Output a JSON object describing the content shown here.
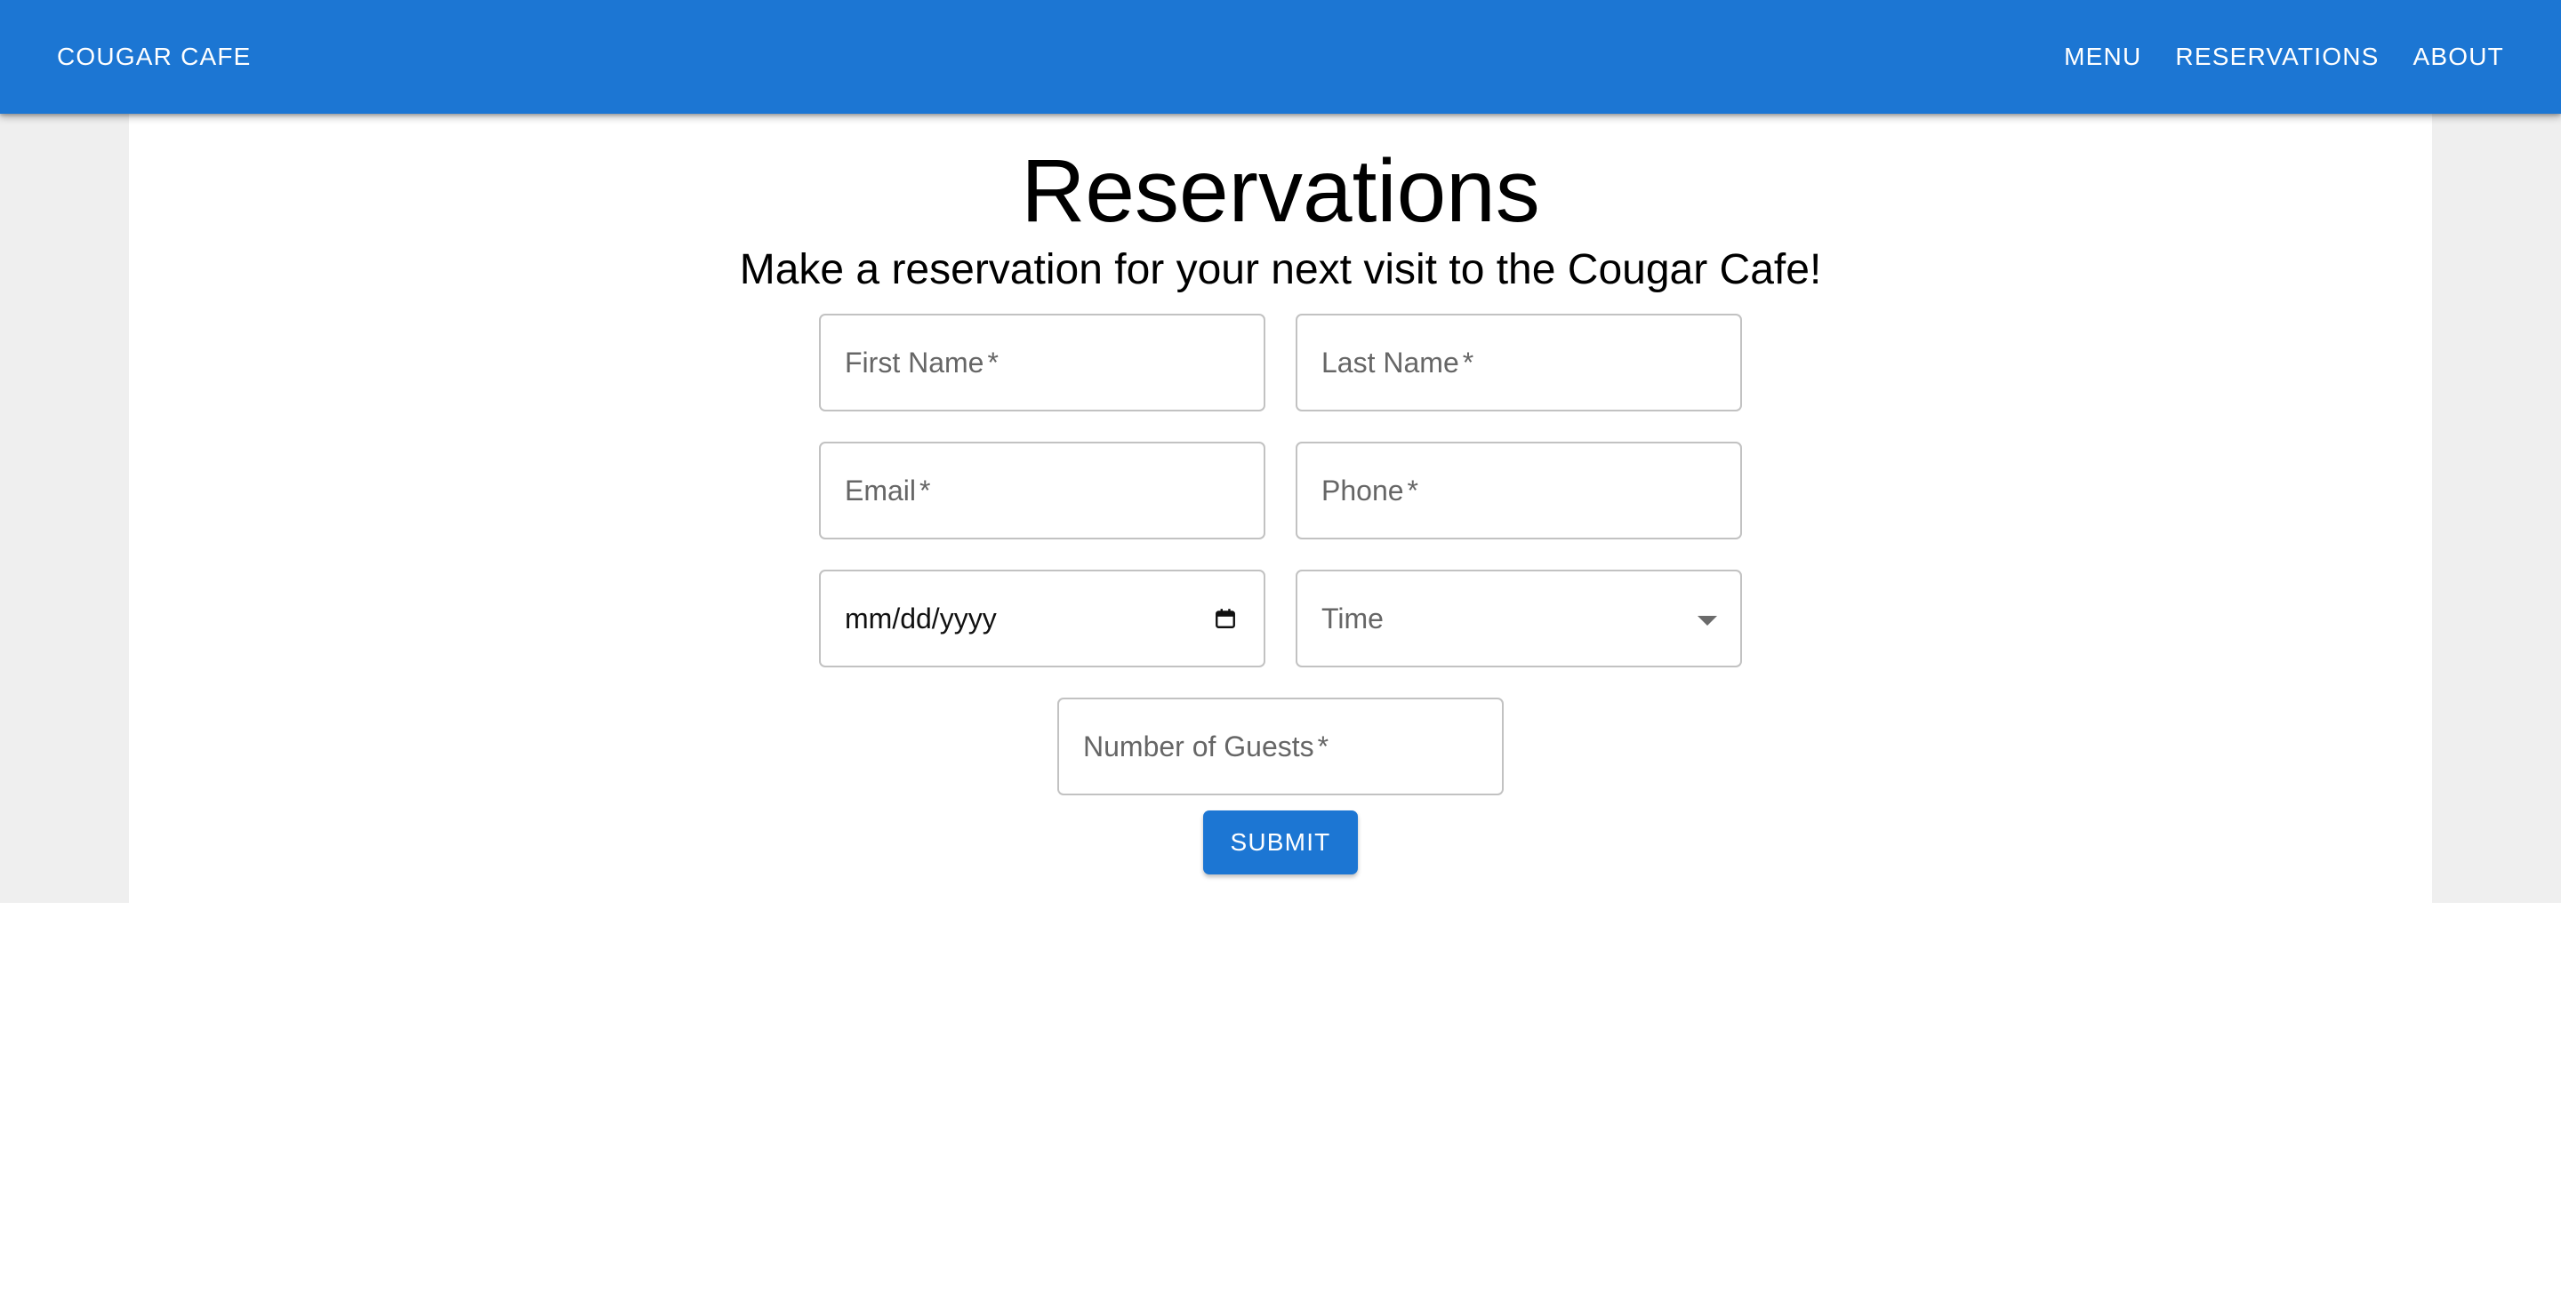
{
  "header": {
    "brand": "COUGAR CAFE",
    "nav": {
      "menu": "MENU",
      "reservations": "RESERVATIONS",
      "about": "ABOUT"
    }
  },
  "page": {
    "title": "Reservations",
    "subtitle": "Make a reservation for your next visit to the Cougar Cafe!"
  },
  "form": {
    "first_name": {
      "label": "First Name",
      "required": "*"
    },
    "last_name": {
      "label": "Last Name",
      "required": "*"
    },
    "email": {
      "label": "Email",
      "required": "*"
    },
    "phone": {
      "label": "Phone",
      "required": "*"
    },
    "date": {
      "placeholder": "mm/dd/yyyy",
      "icon": "calendar-icon"
    },
    "time": {
      "label": "Time",
      "icon": "chevron-down-icon"
    },
    "guests": {
      "label": "Number of Guests",
      "required": "*"
    },
    "submit_label": "SUBMIT"
  },
  "colors": {
    "primary": "#1c76d3",
    "backdrop": "#efefef",
    "field_border": "#c2c2c2",
    "placeholder": "#666666"
  }
}
